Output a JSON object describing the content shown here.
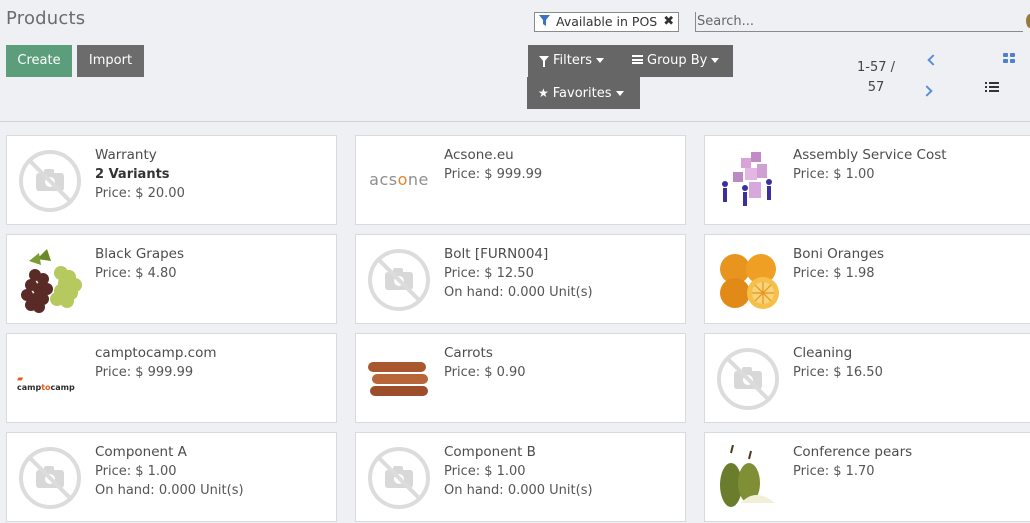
{
  "header": {
    "title": "Products",
    "create_label": "Create",
    "import_label": "Import"
  },
  "search": {
    "facet_label": "Available in POS",
    "facet_close": "✖",
    "placeholder": "Search...",
    "filters_label": "Filters",
    "group_by_label": "Group By",
    "favorites_label": "Favorites"
  },
  "pager": {
    "range": "1-57 /",
    "total": "57"
  },
  "icons": {
    "filter": "funnel-icon",
    "group_by": "bars-icon",
    "favorites": "star-icon",
    "prev": "chevron-left-icon",
    "next": "chevron-right-icon",
    "kanban_view": "grid-icon",
    "list_view": "list-icon"
  },
  "colors": {
    "create": "#5c9e7b",
    "import": "#6c6c6c",
    "dropdown": "#666666",
    "accent": "#4f7fcf",
    "background": "#eef0f4"
  },
  "products": [
    {
      "name": "Warranty",
      "variants": "2 Variants",
      "price": "Price: $ 20.00",
      "onhand": "",
      "image": "placeholder"
    },
    {
      "name": "Acsone.eu",
      "variants": "",
      "price": "Price: $ 999.99",
      "onhand": "",
      "image": "acsone-logo",
      "logo_text": "acsone"
    },
    {
      "name": "Assembly Service Cost",
      "variants": "",
      "price": "Price: $ 1.00",
      "onhand": "",
      "image": "assembly-illustration"
    },
    {
      "name": "Black Grapes",
      "variants": "",
      "price": "Price: $ 4.80",
      "onhand": "",
      "image": "grapes"
    },
    {
      "name": "Bolt [FURN004]",
      "variants": "",
      "price": "Price: $ 12.50",
      "onhand": "On hand: 0.000 Unit(s)",
      "image": "placeholder"
    },
    {
      "name": "Boni Oranges",
      "variants": "",
      "price": "Price: $ 1.98",
      "onhand": "",
      "image": "oranges"
    },
    {
      "name": "camptocamp.com",
      "variants": "",
      "price": "Price: $ 999.99",
      "onhand": "",
      "image": "camptocamp-logo",
      "logo_text": "camptocamp"
    },
    {
      "name": "Carrots",
      "variants": "",
      "price": "Price: $ 0.90",
      "onhand": "",
      "image": "carrots"
    },
    {
      "name": "Cleaning",
      "variants": "",
      "price": "Price: $ 16.50",
      "onhand": "",
      "image": "placeholder"
    },
    {
      "name": "Component A",
      "variants": "",
      "price": "Price: $ 1.00",
      "onhand": "On hand: 0.000 Unit(s)",
      "image": "placeholder"
    },
    {
      "name": "Component B",
      "variants": "",
      "price": "Price: $ 1.00",
      "onhand": "On hand: 0.000 Unit(s)",
      "image": "placeholder"
    },
    {
      "name": "Conference pears",
      "variants": "",
      "price": "Price: $ 1.70",
      "onhand": "",
      "image": "pears"
    }
  ]
}
